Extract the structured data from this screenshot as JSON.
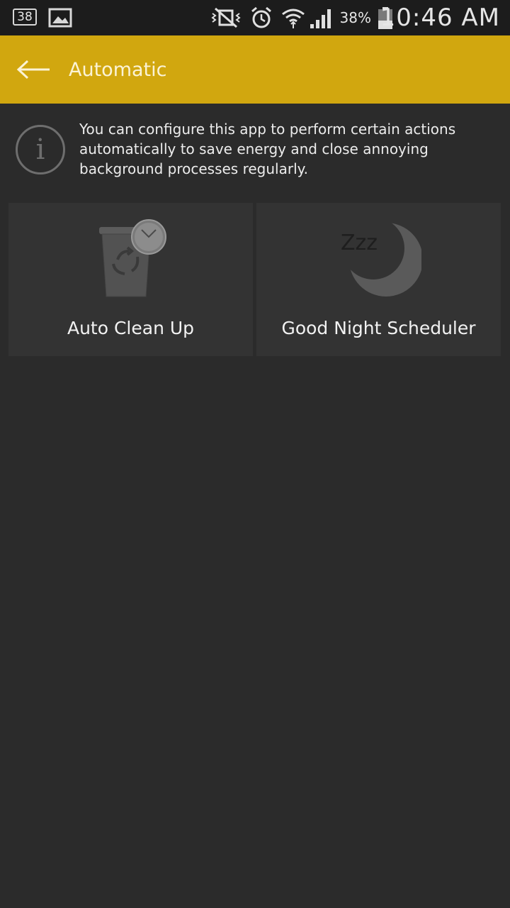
{
  "status_bar": {
    "notification_count": "38",
    "battery_percent": "38%",
    "time": "10:46 AM"
  },
  "app_bar": {
    "title": "Automatic",
    "color": "#d1a70f"
  },
  "info": {
    "text": "You can configure this app to perform certain actions automatically to save energy and close annoying background processes regularly."
  },
  "tiles": [
    {
      "label": "Auto Clean Up",
      "icon": "timed-recycle-bin-icon"
    },
    {
      "label": "Good Night Scheduler",
      "icon": "moon-sleep-icon",
      "icon_text": "Zzz"
    }
  ]
}
